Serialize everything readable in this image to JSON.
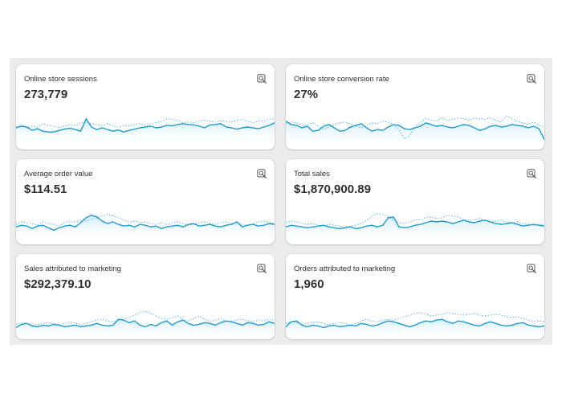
{
  "cards": [
    {
      "title": "Online store sessions",
      "value": "273,779",
      "icon": "magnifier-report-icon",
      "current": [
        0.52,
        0.48,
        0.5,
        0.58,
        0.54,
        0.6,
        0.62,
        0.62,
        0.58,
        0.55,
        0.53,
        0.56,
        0.6,
        0.3,
        0.5,
        0.56,
        0.52,
        0.56,
        0.6,
        0.57,
        0.62,
        0.58,
        0.55,
        0.52,
        0.5,
        0.48,
        0.52,
        0.5,
        0.46,
        0.47,
        0.44,
        0.42,
        0.44,
        0.45,
        0.48,
        0.52,
        0.45,
        0.44,
        0.42,
        0.5,
        0.52,
        0.55,
        0.52,
        0.5,
        0.52,
        0.54,
        0.5,
        0.46,
        0.4
      ],
      "previous": [
        0.5,
        0.44,
        0.52,
        0.48,
        0.5,
        0.42,
        0.46,
        0.48,
        0.52,
        0.48,
        0.44,
        0.46,
        0.4,
        0.38,
        0.42,
        0.44,
        0.46,
        0.42,
        0.48,
        0.5,
        0.46,
        0.48,
        0.44,
        0.42,
        0.46,
        0.44,
        0.4,
        0.36,
        0.3,
        0.32,
        0.34,
        0.4,
        0.38,
        0.4,
        0.36,
        0.34,
        0.36,
        0.38,
        0.35,
        0.36,
        0.38,
        0.34,
        0.32,
        0.36,
        0.4,
        0.36,
        0.35,
        0.32,
        0.3
      ]
    },
    {
      "title": "Online store conversion rate",
      "value": "27%",
      "icon": "magnifier-report-icon",
      "current": [
        0.36,
        0.44,
        0.46,
        0.52,
        0.48,
        0.6,
        0.58,
        0.48,
        0.44,
        0.52,
        0.6,
        0.58,
        0.5,
        0.46,
        0.42,
        0.52,
        0.6,
        0.56,
        0.58,
        0.5,
        0.44,
        0.46,
        0.54,
        0.56,
        0.52,
        0.48,
        0.4,
        0.44,
        0.48,
        0.46,
        0.5,
        0.52,
        0.48,
        0.44,
        0.46,
        0.52,
        0.58,
        0.54,
        0.48,
        0.46,
        0.5,
        0.48,
        0.44,
        0.46,
        0.48,
        0.52,
        0.48,
        0.54,
        0.8
      ],
      "previous": [
        0.42,
        0.38,
        0.4,
        0.46,
        0.44,
        0.4,
        0.48,
        0.56,
        0.5,
        0.44,
        0.4,
        0.38,
        0.42,
        0.48,
        0.52,
        0.46,
        0.4,
        0.42,
        0.36,
        0.38,
        0.44,
        0.56,
        0.78,
        0.7,
        0.5,
        0.4,
        0.3,
        0.34,
        0.36,
        0.28,
        0.34,
        0.32,
        0.28,
        0.3,
        0.34,
        0.28,
        0.3,
        0.32,
        0.28,
        0.34,
        0.38,
        0.24,
        0.3,
        0.36,
        0.4,
        0.44,
        0.38,
        0.46,
        0.5
      ]
    },
    {
      "title": "Average order value",
      "value": "$114.51",
      "icon": "magnifier-report-icon",
      "current": [
        0.62,
        0.58,
        0.6,
        0.66,
        0.6,
        0.58,
        0.64,
        0.7,
        0.64,
        0.6,
        0.58,
        0.62,
        0.52,
        0.4,
        0.34,
        0.38,
        0.48,
        0.54,
        0.5,
        0.56,
        0.6,
        0.58,
        0.62,
        0.56,
        0.58,
        0.62,
        0.6,
        0.66,
        0.62,
        0.6,
        0.58,
        0.62,
        0.56,
        0.54,
        0.6,
        0.58,
        0.56,
        0.6,
        0.62,
        0.58,
        0.56,
        0.5,
        0.62,
        0.58,
        0.56,
        0.6,
        0.58,
        0.54,
        0.56
      ],
      "previous": [
        0.56,
        0.5,
        0.52,
        0.54,
        0.58,
        0.5,
        0.54,
        0.56,
        0.6,
        0.52,
        0.48,
        0.5,
        0.46,
        0.48,
        0.44,
        0.4,
        0.36,
        0.32,
        0.36,
        0.4,
        0.46,
        0.5,
        0.48,
        0.52,
        0.5,
        0.54,
        0.56,
        0.52,
        0.56,
        0.54,
        0.5,
        0.54,
        0.58,
        0.56,
        0.52,
        0.5,
        0.54,
        0.56,
        0.52,
        0.5,
        0.54,
        0.52,
        0.56,
        0.58,
        0.54,
        0.5,
        0.48,
        0.52,
        0.54
      ]
    },
    {
      "title": "Total sales",
      "value": "$1,870,900.89",
      "icon": "magnifier-report-icon",
      "current": [
        0.62,
        0.58,
        0.6,
        0.62,
        0.64,
        0.62,
        0.6,
        0.58,
        0.62,
        0.64,
        0.66,
        0.64,
        0.62,
        0.66,
        0.64,
        0.6,
        0.58,
        0.62,
        0.58,
        0.4,
        0.38,
        0.62,
        0.64,
        0.62,
        0.58,
        0.56,
        0.52,
        0.48,
        0.5,
        0.48,
        0.5,
        0.54,
        0.5,
        0.46,
        0.5,
        0.52,
        0.48,
        0.46,
        0.5,
        0.54,
        0.56,
        0.54,
        0.52,
        0.56,
        0.6,
        0.58,
        0.56,
        0.58,
        0.6
      ],
      "previous": [
        0.52,
        0.48,
        0.5,
        0.54,
        0.56,
        0.54,
        0.58,
        0.6,
        0.56,
        0.58,
        0.6,
        0.62,
        0.6,
        0.58,
        0.54,
        0.46,
        0.36,
        0.3,
        0.32,
        0.38,
        0.46,
        0.52,
        0.54,
        0.5,
        0.46,
        0.44,
        0.4,
        0.38,
        0.42,
        0.4,
        0.34,
        0.36,
        0.38,
        0.44,
        0.46,
        0.44,
        0.42,
        0.46,
        0.5,
        0.48,
        0.46,
        0.5,
        0.52,
        0.5,
        0.54,
        0.56,
        0.58,
        0.56,
        0.58
      ]
    },
    {
      "title": "Sales attributed to marketing",
      "value": "$292,379.10",
      "icon": "magnifier-report-icon",
      "current": [
        0.76,
        0.68,
        0.66,
        0.72,
        0.74,
        0.7,
        0.72,
        0.68,
        0.7,
        0.74,
        0.72,
        0.7,
        0.74,
        0.72,
        0.7,
        0.66,
        0.7,
        0.72,
        0.7,
        0.56,
        0.58,
        0.64,
        0.6,
        0.7,
        0.74,
        0.68,
        0.72,
        0.64,
        0.6,
        0.7,
        0.62,
        0.58,
        0.66,
        0.7,
        0.68,
        0.64,
        0.66,
        0.7,
        0.64,
        0.6,
        0.62,
        0.66,
        0.7,
        0.64,
        0.66,
        0.7,
        0.68,
        0.62,
        0.66
      ],
      "previous": [
        0.68,
        0.64,
        0.66,
        0.7,
        0.68,
        0.66,
        0.64,
        0.66,
        0.7,
        0.66,
        0.62,
        0.66,
        0.7,
        0.66,
        0.62,
        0.58,
        0.56,
        0.6,
        0.62,
        0.58,
        0.56,
        0.52,
        0.46,
        0.4,
        0.36,
        0.42,
        0.48,
        0.54,
        0.56,
        0.52,
        0.48,
        0.56,
        0.6,
        0.54,
        0.48,
        0.56,
        0.62,
        0.58,
        0.54,
        0.6,
        0.62,
        0.58,
        0.56,
        0.6,
        0.62,
        0.58,
        0.6,
        0.56,
        0.58
      ]
    },
    {
      "title": "Orders attributed to marketing",
      "value": "1,960",
      "icon": "magnifier-report-icon",
      "current": [
        0.74,
        0.62,
        0.6,
        0.7,
        0.74,
        0.7,
        0.72,
        0.76,
        0.72,
        0.7,
        0.74,
        0.72,
        0.7,
        0.72,
        0.66,
        0.68,
        0.72,
        0.7,
        0.64,
        0.6,
        0.62,
        0.66,
        0.7,
        0.74,
        0.7,
        0.64,
        0.6,
        0.62,
        0.58,
        0.56,
        0.62,
        0.66,
        0.6,
        0.62,
        0.66,
        0.7,
        0.72,
        0.66,
        0.62,
        0.66,
        0.7,
        0.72,
        0.7,
        0.66,
        0.64,
        0.7,
        0.72,
        0.74,
        0.72
      ],
      "previous": [
        0.66,
        0.62,
        0.64,
        0.68,
        0.66,
        0.64,
        0.62,
        0.66,
        0.68,
        0.66,
        0.64,
        0.66,
        0.7,
        0.66,
        0.6,
        0.56,
        0.6,
        0.62,
        0.58,
        0.56,
        0.58,
        0.54,
        0.5,
        0.46,
        0.42,
        0.4,
        0.44,
        0.48,
        0.46,
        0.44,
        0.4,
        0.42,
        0.44,
        0.46,
        0.44,
        0.42,
        0.46,
        0.48,
        0.46,
        0.44,
        0.46,
        0.5,
        0.52,
        0.5,
        0.54,
        0.58,
        0.62,
        0.6,
        0.62
      ]
    }
  ],
  "colors": {
    "line": "#1d9bd1",
    "dotted": "#5fb8e0",
    "fill_top": "#cbe9f7",
    "fill_bottom": "#ffffff"
  }
}
